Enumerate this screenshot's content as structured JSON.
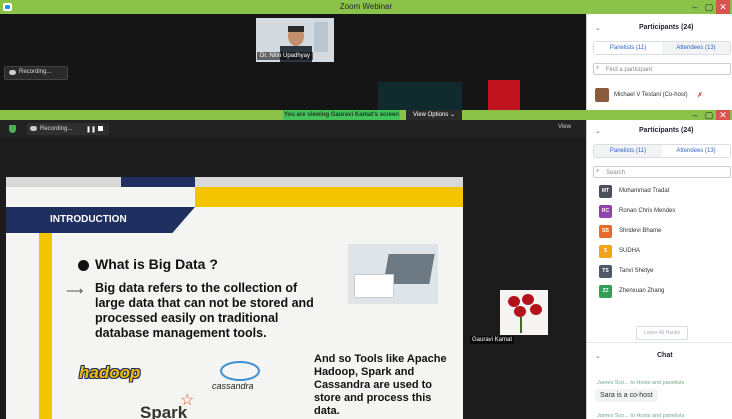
{
  "back_window": {
    "title": "Zoom Webinar",
    "speaker_name": "Dr. Nitin Upadhyay",
    "recording_label": "Recording...",
    "controls": {
      "min": "–",
      "max": "▢",
      "close": "✕"
    },
    "participants": {
      "header": "Participants (24)",
      "tabs": [
        "Panelists (11)",
        "Attendees (13)"
      ],
      "search_placeholder": "Find a participant",
      "visible_row": "Michael V Testani (Co-host)"
    }
  },
  "front_window": {
    "banner": "You are viewing Gauravi Kamat's screen",
    "view_options": "View Options ⌄",
    "recording_label": "Recording...",
    "view_label": "View",
    "controls": {
      "min": "–",
      "max": "▢",
      "close": "✕"
    },
    "slide": {
      "section": "INTRODUCTION",
      "heading": "What is Big Data ?",
      "body": "Big data refers to the collection of large data that can not be stored and processed easily on traditional database management tools.",
      "tools_text": "And so Tools like Apache Hadoop, Spark and Cassandra are used to store and process this data.",
      "logo_hadoop": "hadoop",
      "logo_cassandra": "cassandra",
      "logo_spark": "Spark"
    },
    "thumbnail_name": "Gauravi Kamat",
    "participants": {
      "header": "Participants (24)",
      "tabs": [
        "Panelists (11)",
        "Attendees (13)"
      ],
      "search_placeholder": "Search",
      "list": [
        {
          "initials": "MT",
          "name": "Mohammad Tradat",
          "color": "#4a4f5a"
        },
        {
          "initials": "RC",
          "name": "Ronan Chris Mendes",
          "color": "#8e44ad"
        },
        {
          "initials": "SB",
          "name": "Shridevi Bhame",
          "color": "#e86a2a"
        },
        {
          "initials": "S",
          "name": "SUDHA",
          "color": "#f2a316"
        },
        {
          "initials": "TS",
          "name": "Tanvi Shetye",
          "color": "#4f5a66"
        },
        {
          "initials": "ZZ",
          "name": "Zhenxuan Zhang",
          "color": "#2f9e57"
        }
      ],
      "lower_hands": "Lower All Hands"
    },
    "chat": {
      "header": "Chat",
      "meta1": "James Sco... to Hosts and panelists",
      "message1": "Sara is a co-host",
      "meta2": "James Sco... to Hosts and panelists"
    }
  }
}
